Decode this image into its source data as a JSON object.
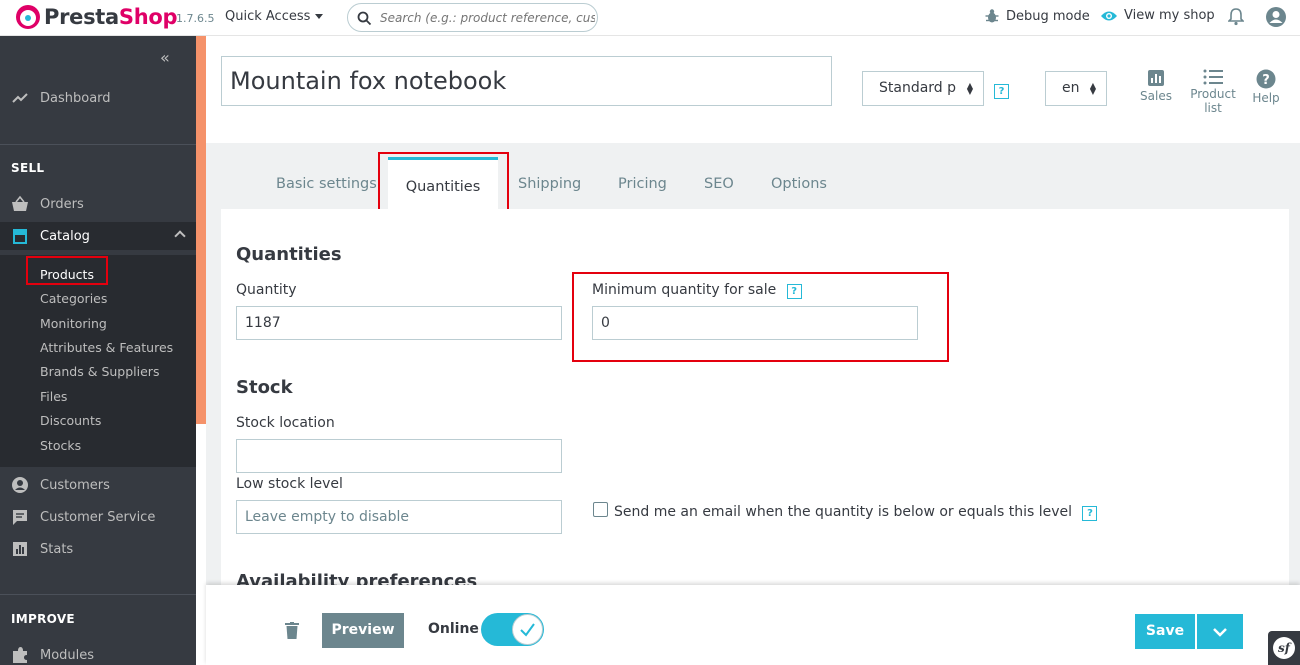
{
  "header": {
    "logo_presta": "Presta",
    "logo_shop": "Shop",
    "version": "1.7.6.5",
    "quick_access": "Quick Access",
    "search_placeholder": "Search (e.g.: product reference, customer name...)",
    "debug_mode": "Debug mode",
    "view_my_shop": "View my shop"
  },
  "sidebar": {
    "dashboard": "Dashboard",
    "sell_section": "SELL",
    "orders": "Orders",
    "catalog": "Catalog",
    "catalog_items": [
      "Products",
      "Categories",
      "Monitoring",
      "Attributes & Features",
      "Brands & Suppliers",
      "Files",
      "Discounts",
      "Stocks"
    ],
    "customers": "Customers",
    "customer_service": "Customer Service",
    "stats": "Stats",
    "improve_section": "IMPROVE",
    "modules": "Modules"
  },
  "product": {
    "name": "Mountain fox notebook",
    "type_select": "Standard p",
    "lang_select": "en",
    "sales": "Sales",
    "product_list": "Product list",
    "help": "Help"
  },
  "tabs": [
    "Basic settings",
    "Quantities",
    "Shipping",
    "Pricing",
    "SEO",
    "Options"
  ],
  "quantities": {
    "title": "Quantities",
    "quantity_label": "Quantity",
    "quantity_value": "1187",
    "min_qty_label": "Minimum quantity for sale",
    "min_qty_value": "0",
    "help_glyph": "?"
  },
  "stock": {
    "title": "Stock",
    "location_label": "Stock location",
    "location_value": "",
    "low_stock_label": "Low stock level",
    "low_stock_placeholder": "Leave empty to disable",
    "email_checkbox_label": "Send me an email when the quantity is below or equals this level"
  },
  "availability_title": "Availability preferences",
  "footer": {
    "preview": "Preview",
    "online": "Online",
    "save": "Save",
    "symfony_glyph": "sf"
  },
  "colors": {
    "accent": "#25b9d7",
    "sidebar_bg": "#363a41",
    "brand_pink": "#df0067",
    "highlight_red": "#e4000e"
  }
}
